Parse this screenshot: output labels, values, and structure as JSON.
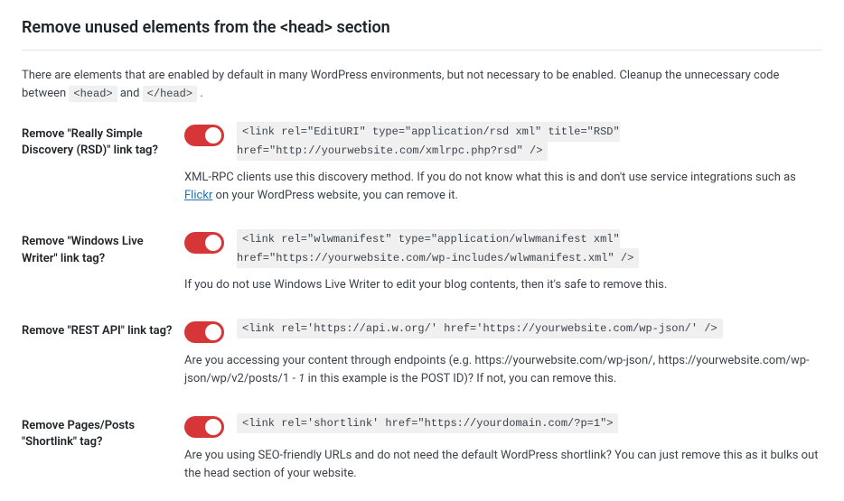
{
  "section": {
    "title": "Remove unused elements from the <head> section",
    "desc_before": "There are elements that are enabled by default in many WordPress environments, but not necessary to be enabled. Cleanup the unnecessary code between ",
    "code_open": "<head>",
    "desc_mid": " and ",
    "code_close": "</head>",
    "desc_after": " ."
  },
  "settings": [
    {
      "label": "Remove \"Really Simple Discovery (RSD)\" link tag?",
      "code": "<link rel=\"EditURI\" type=\"application/rsd xml\" title=\"RSD\" href=\"http://yourwebsite.com/xmlrpc.php?rsd\" />",
      "desc_pre": "XML-RPC clients use this discovery method. If you do not know what this is and don't use service integrations such as ",
      "link_text": "Flickr",
      "desc_post": " on your WordPress website, you can remove it."
    },
    {
      "label": "Remove \"Windows Live Writer\" link tag?",
      "code": "<link rel=\"wlwmanifest\" type=\"application/wlwmanifest xml\" href=\"https://yourwebsite.com/wp-includes/wlwmanifest.xml\" />",
      "desc": "If you do not use Windows Live Writer to edit your blog contents, then it's safe to remove this."
    },
    {
      "label": "Remove \"REST API\" link tag?",
      "code": "<link rel='https://api.w.org/' href='https://yourwebsite.com/wp-json/' />",
      "desc_pre": "Are you accessing your content through endpoints (e.g. https://yourwebsite.com/wp-json/, https://yourwebsite.com/wp-json/wp/v2/posts/1 - ",
      "em": "1",
      "desc_post": " in this example is the POST ID)? If not, you can remove this."
    },
    {
      "label": "Remove Pages/Posts \"Shortlink\" tag?",
      "code": "<link rel='shortlink' href=\"https://yourdomain.com/?p=1\">",
      "desc": "Are you using SEO-friendly URLs and do not need the default WordPress shortlink? You can just remove this as it bulks out the head section of your website."
    }
  ]
}
